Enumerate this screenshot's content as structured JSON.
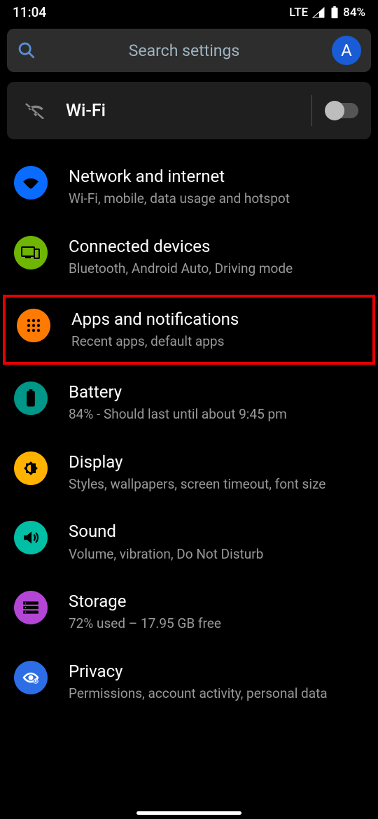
{
  "status": {
    "time": "11:04",
    "network_label": "LTE",
    "battery_pct": "84%"
  },
  "search": {
    "placeholder": "Search settings",
    "avatar_letter": "A"
  },
  "wifi_toggle": {
    "label": "Wi-Fi",
    "on": false
  },
  "items": [
    {
      "title": "Network and internet",
      "subtitle": "Wi-Fi, mobile, data usage and hotspot",
      "icon": "wifi-icon",
      "color": "c-blue1",
      "highlighted": false
    },
    {
      "title": "Connected devices",
      "subtitle": "Bluetooth, Android Auto, Driving mode",
      "icon": "devices-icon",
      "color": "c-green",
      "highlighted": false
    },
    {
      "title": "Apps and notifications",
      "subtitle": "Recent apps, default apps",
      "icon": "apps-icon",
      "color": "c-orange",
      "highlighted": true
    },
    {
      "title": "Battery",
      "subtitle": "84% - Should last until about 9:45 pm",
      "icon": "battery-icon",
      "color": "c-teal",
      "highlighted": false
    },
    {
      "title": "Display",
      "subtitle": "Styles, wallpapers, screen timeout, font size",
      "icon": "brightness-icon",
      "color": "c-yellow",
      "highlighted": false
    },
    {
      "title": "Sound",
      "subtitle": "Volume, vibration, Do Not Disturb",
      "icon": "sound-icon",
      "color": "c-cyan",
      "highlighted": false
    },
    {
      "title": "Storage",
      "subtitle": "72% used – 17.95 GB free",
      "icon": "storage-icon",
      "color": "c-purple",
      "highlighted": false
    },
    {
      "title": "Privacy",
      "subtitle": "Permissions, account activity, personal data",
      "icon": "privacy-icon",
      "color": "c-blue2",
      "highlighted": false
    }
  ],
  "cutoff_item": {
    "title_partial": ""
  }
}
